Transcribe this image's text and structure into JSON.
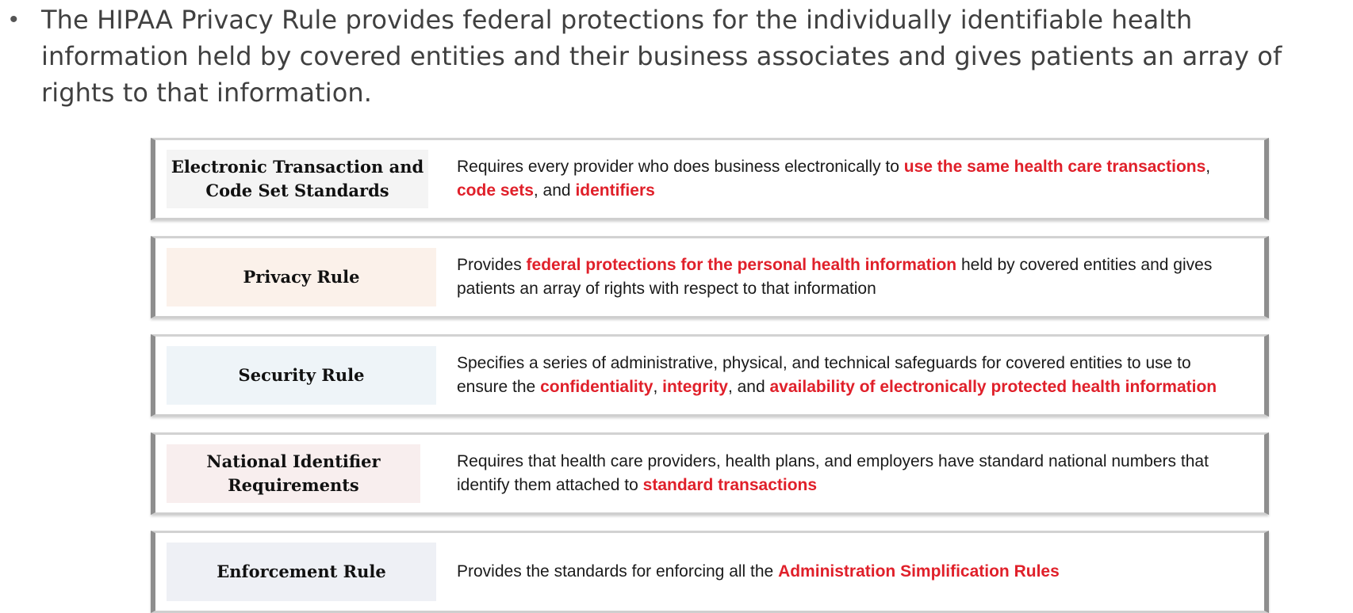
{
  "bullet": {
    "symbol": "•",
    "text": "The HIPAA Privacy Rule provides federal protections for the individually identifiable health information held by covered entities and their business associates and gives patients an array of rights to that information."
  },
  "colors": {
    "highlight": "#e0202a",
    "body_text": "#404040"
  },
  "rules": [
    {
      "name": "Electronic Transaction and Code Set Standards",
      "description": [
        {
          "text": "Requires every provider who does business electronically to ",
          "highlight": false
        },
        {
          "text": "use the same health care transactions",
          "highlight": true
        },
        {
          "text": ", ",
          "highlight": false
        },
        {
          "text": "code sets",
          "highlight": true
        },
        {
          "text": ", and ",
          "highlight": false
        },
        {
          "text": "identifiers",
          "highlight": true
        }
      ]
    },
    {
      "name": "Privacy Rule",
      "description": [
        {
          "text": "Provides ",
          "highlight": false
        },
        {
          "text": "federal protections for the personal health information",
          "highlight": true
        },
        {
          "text": " held by covered entities and gives patients an array of rights with respect to that information",
          "highlight": false
        }
      ]
    },
    {
      "name": "Security Rule",
      "description": [
        {
          "text": "Specifies a series of administrative, physical, and technical safeguards for covered entities to use to ensure the ",
          "highlight": false
        },
        {
          "text": "confidentiality",
          "highlight": true
        },
        {
          "text": ", ",
          "highlight": false
        },
        {
          "text": "integrity",
          "highlight": true
        },
        {
          "text": ", and ",
          "highlight": false
        },
        {
          "text": "availability of electronically protected health information",
          "highlight": true
        }
      ]
    },
    {
      "name": "National Identifier Requirements",
      "description": [
        {
          "text": "Requires that health care providers, health plans, and employers have standard national numbers that identify them attached to ",
          "highlight": false
        },
        {
          "text": "standard transactions",
          "highlight": true
        }
      ]
    },
    {
      "name": "Enforcement Rule",
      "description": [
        {
          "text": "Provides the standards for enforcing all the ",
          "highlight": false
        },
        {
          "text": "Administration Simplification Rules",
          "highlight": true
        }
      ]
    }
  ]
}
